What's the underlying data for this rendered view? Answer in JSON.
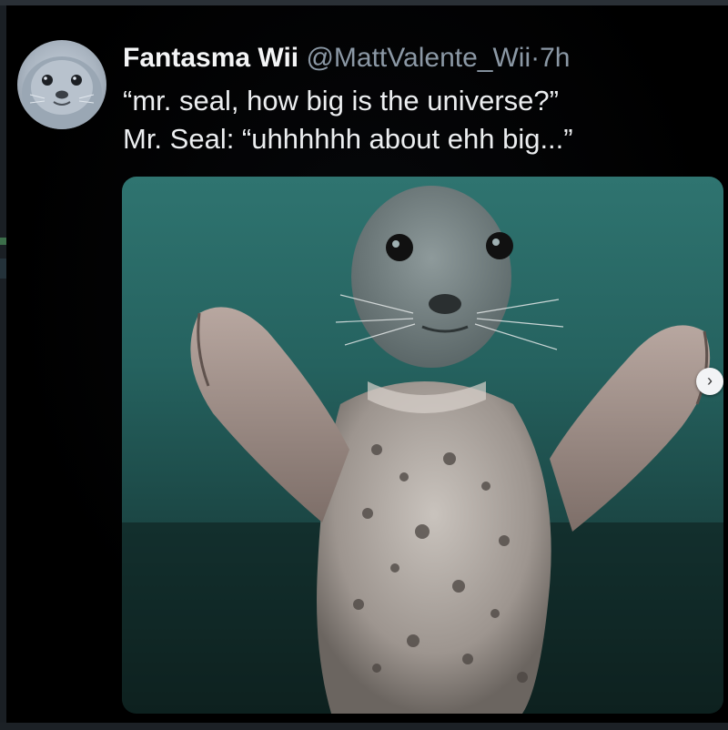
{
  "tweet": {
    "display_name": "Fantasma Wii",
    "handle": "@MattValente_Wii",
    "separator": "·",
    "time": "7h",
    "lines": [
      "“mr. seal, how big is the universe?”",
      "Mr. Seal: “uhhhhhh about ehh big...”"
    ]
  },
  "media": {
    "next_icon": "chevron-right-icon",
    "next_glyph": "›"
  },
  "colors": {
    "background": "#000000",
    "name": "#f4f5f6",
    "muted": "#8b98a5",
    "water": "#2f7470"
  }
}
